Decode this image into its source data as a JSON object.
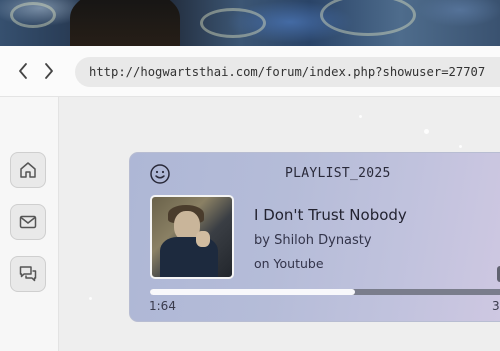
{
  "browser": {
    "url": "http://hogwartsthai.com/forum/index.php?showuser=27707",
    "back_icon": "chevron-left-icon",
    "forward_icon": "chevron-right-icon"
  },
  "sidebar": {
    "items": [
      {
        "icon": "home-icon"
      },
      {
        "icon": "mail-icon"
      },
      {
        "icon": "chat-icon"
      }
    ]
  },
  "player": {
    "playlist_title": "PLAYLIST_2025",
    "song_title": "I Don't Trust Nobody",
    "artist_line": "by Shiloh Dynasty",
    "platform_line": "on Youtube",
    "current_time": "1:64",
    "duration": "3",
    "progress": 0.57
  },
  "colors": {
    "card_gradient_start": "#aeb7d6",
    "card_gradient_end": "#cfc8e2",
    "progress_fill": "#f8f8fb",
    "progress_track": "#7a7d8c"
  }
}
